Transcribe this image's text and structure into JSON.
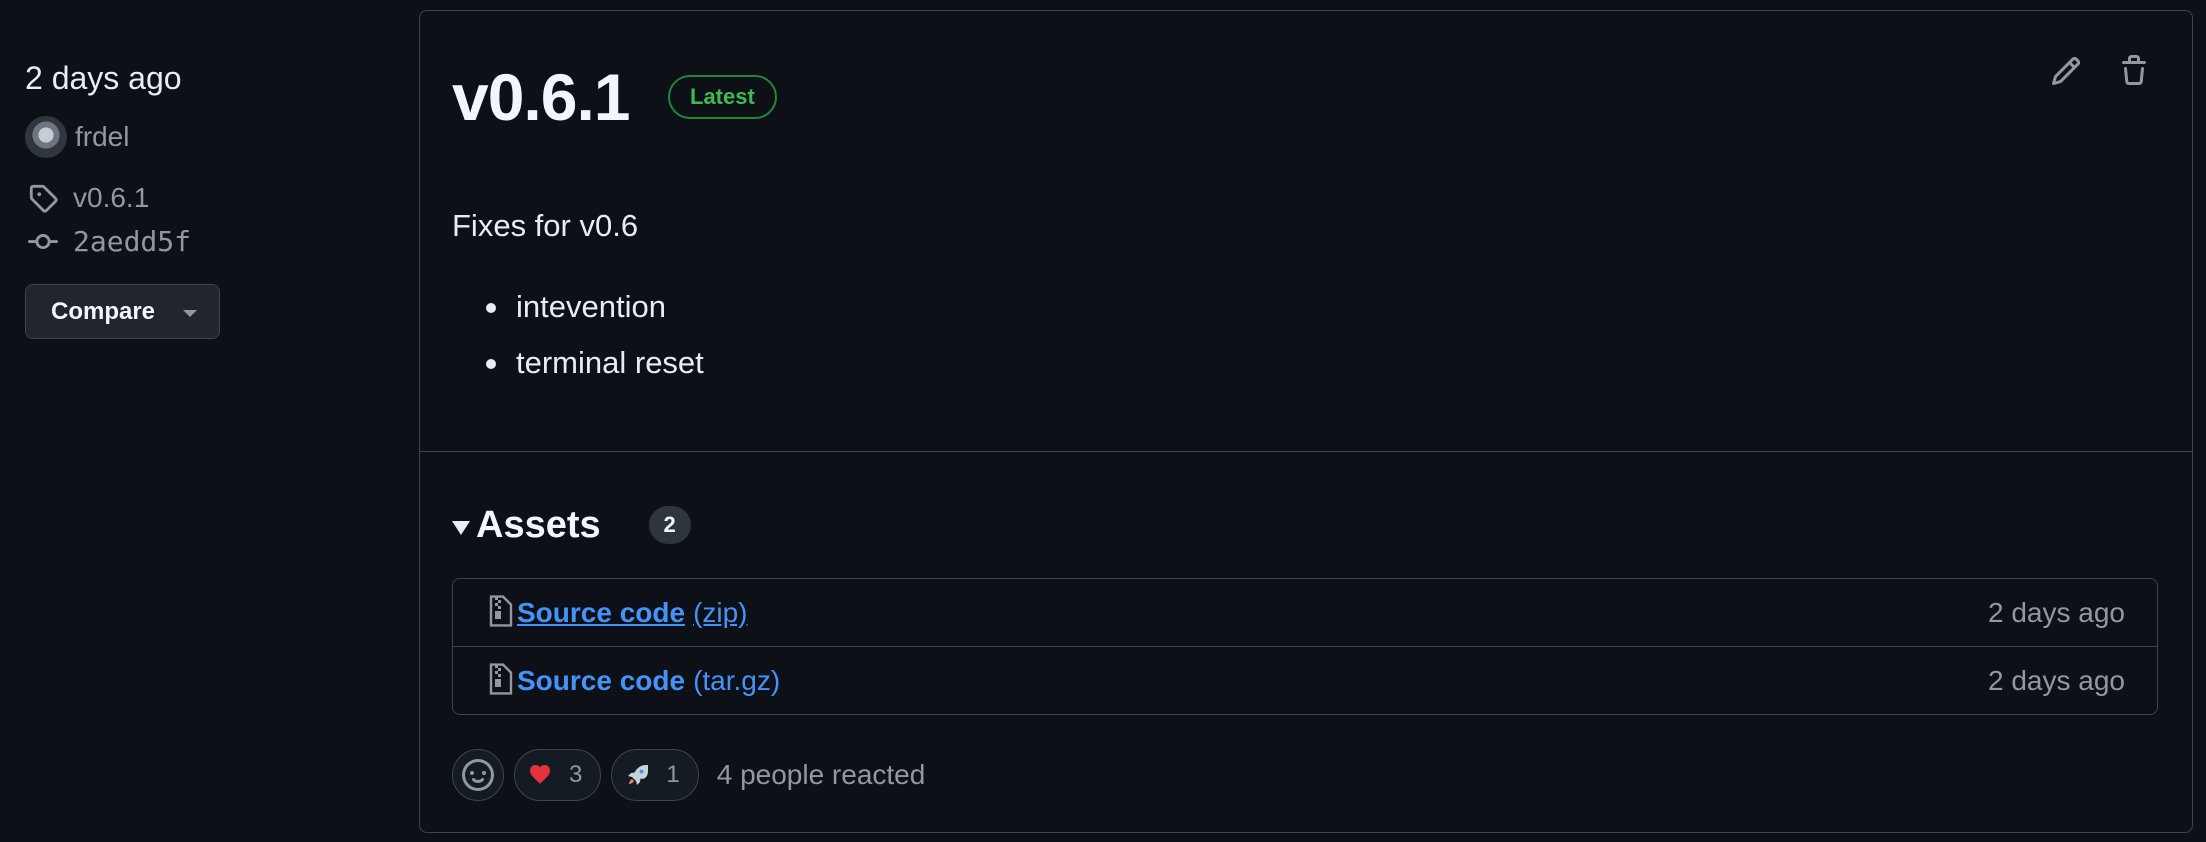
{
  "sidebar": {
    "date": "2 days ago",
    "author": "frdel",
    "tag": "v0.6.1",
    "commit": "2aedd5f",
    "compare_label": "Compare"
  },
  "release": {
    "version": "v0.6.1",
    "badge": "Latest",
    "notes_title": "Fixes for v0.6",
    "notes_items": [
      "intevention",
      "terminal reset"
    ]
  },
  "assets": {
    "title": "Assets",
    "count": "2",
    "items": [
      {
        "name": "Source code",
        "ext": "(zip)",
        "time": "2 days ago"
      },
      {
        "name": "Source code",
        "ext": "(tar.gz)",
        "time": "2 days ago"
      }
    ]
  },
  "reactions": {
    "items": [
      {
        "icon": "heart-icon",
        "count": "3"
      },
      {
        "icon": "rocket-icon",
        "count": "1"
      }
    ],
    "summary": "4 people reacted"
  },
  "colors": {
    "background": "#0d1117",
    "link": "#4493f8",
    "latest_badge": "#3fb950",
    "border": "#3d444d"
  }
}
